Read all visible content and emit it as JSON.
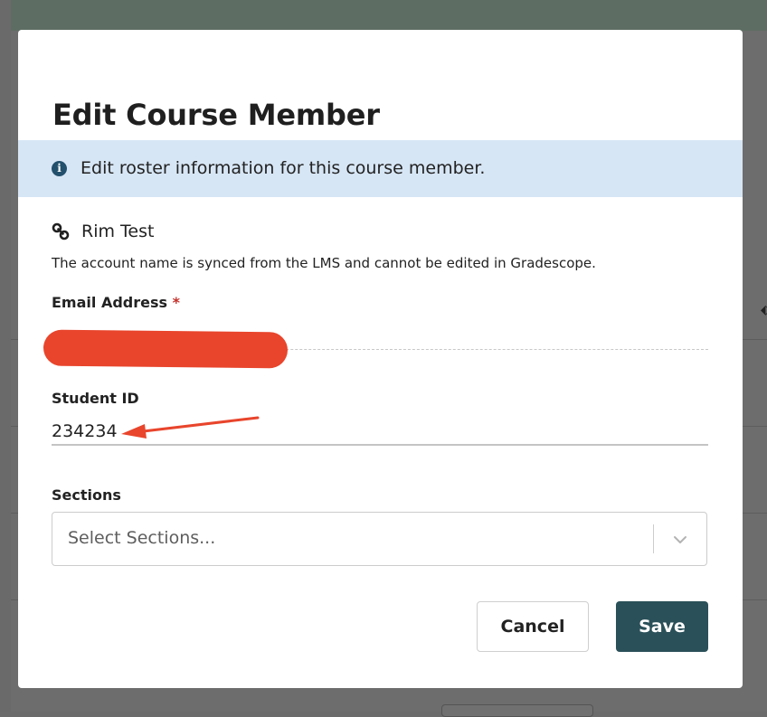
{
  "modal": {
    "title": "Edit Course Member",
    "banner": {
      "icon": "info-icon",
      "text": "Edit roster information for this course member."
    },
    "account": {
      "icon": "link-icon",
      "name": "Rim Test",
      "note": "The account name is synced from the LMS and cannot be edited in Gradescope."
    },
    "email": {
      "label": "Email Address",
      "required_marker": "*",
      "value": ""
    },
    "student_id": {
      "label": "Student ID",
      "value": "234234"
    },
    "sections": {
      "label": "Sections",
      "placeholder": "Select Sections...",
      "icon": "chevron-down-icon"
    },
    "buttons": {
      "cancel": "Cancel",
      "save": "Save"
    }
  },
  "colors": {
    "save_button": "#2a5059",
    "banner_bg": "#d7e6f5",
    "required": "#c4302b",
    "annotation": "#e8452c"
  }
}
